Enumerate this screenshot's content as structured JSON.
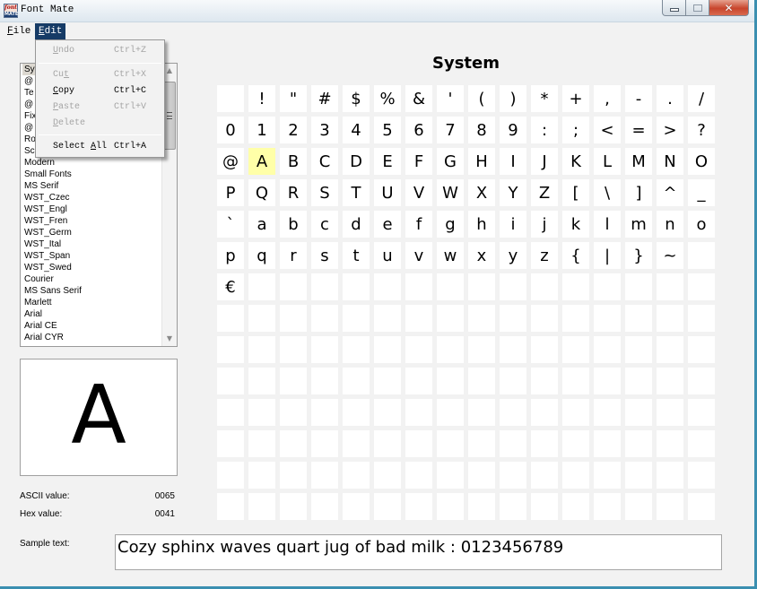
{
  "window": {
    "title": "Font Mate",
    "icon_top": "font",
    "icon_bottom": "MATE",
    "controls": {
      "minimize": "minimize-icon",
      "maximize": "maximize-icon",
      "close_glyph": "✕"
    }
  },
  "menubar": {
    "file": {
      "accel": "F",
      "rest": "ile"
    },
    "edit": {
      "accel": "E",
      "rest": "dit"
    }
  },
  "edit_menu": {
    "items": [
      {
        "pre": "",
        "accel": "U",
        "post": "ndo",
        "shortcut": "Ctrl+Z",
        "enabled": false
      },
      {
        "pre": "Cu",
        "accel": "t",
        "post": "",
        "shortcut": "Ctrl+X",
        "enabled": false
      },
      {
        "pre": "",
        "accel": "C",
        "post": "opy",
        "shortcut": "Ctrl+C",
        "enabled": true
      },
      {
        "pre": "",
        "accel": "P",
        "post": "aste",
        "shortcut": "Ctrl+V",
        "enabled": false
      },
      {
        "pre": "",
        "accel": "D",
        "post": "elete",
        "shortcut": "",
        "enabled": false
      },
      {
        "pre": "Select ",
        "accel": "A",
        "post": "ll",
        "shortcut": "Ctrl+A",
        "enabled": true
      }
    ]
  },
  "font_list": {
    "selected_index": 0,
    "items": [
      "Sy",
      "@",
      "Te",
      "@",
      "Fix",
      "@",
      "Ro",
      "Sc",
      "Modern",
      "Small Fonts",
      "MS Serif",
      "WST_Czec",
      "WST_Engl",
      "WST_Fren",
      "WST_Germ",
      "WST_Ital",
      "WST_Span",
      "WST_Swed",
      "Courier",
      "MS Sans Serif",
      "Marlett",
      "Arial",
      "Arial CE",
      "Arial CYR"
    ],
    "scroll_up": "▲",
    "scroll_down": "▼"
  },
  "preview": {
    "char": "A"
  },
  "info": {
    "ascii_label": "ASCII value:",
    "ascii_value": "0065",
    "hex_label": "Hex value:",
    "hex_value": "0041"
  },
  "sample": {
    "label": "Sample text:",
    "text": "Cozy sphinx waves quart jug of bad milk : 0123456789"
  },
  "char_map": {
    "font_name": "System",
    "selected_char": "A",
    "rows": [
      [
        " ",
        "!",
        "\"",
        "#",
        "$",
        "%",
        "&",
        "'",
        "(",
        ")",
        "*",
        "+",
        ",",
        "-",
        ".",
        "/"
      ],
      [
        "0",
        "1",
        "2",
        "3",
        "4",
        "5",
        "6",
        "7",
        "8",
        "9",
        ":",
        ";",
        "<",
        "=",
        ">",
        "?"
      ],
      [
        "@",
        "A",
        "B",
        "C",
        "D",
        "E",
        "F",
        "G",
        "H",
        "I",
        "J",
        "K",
        "L",
        "M",
        "N",
        "O"
      ],
      [
        "P",
        "Q",
        "R",
        "S",
        "T",
        "U",
        "V",
        "W",
        "X",
        "Y",
        "Z",
        "[",
        "\\",
        "]",
        "^",
        "_"
      ],
      [
        "`",
        "a",
        "b",
        "c",
        "d",
        "e",
        "f",
        "g",
        "h",
        "i",
        "j",
        "k",
        "l",
        "m",
        "n",
        "o"
      ],
      [
        "p",
        "q",
        "r",
        "s",
        "t",
        "u",
        "v",
        "w",
        "x",
        "y",
        "z",
        "{",
        "|",
        "}",
        "~",
        ""
      ],
      [
        "€",
        "",
        "",
        "",
        "",
        "",
        "",
        "",
        "",
        "",
        "",
        "",
        "",
        "",
        "",
        ""
      ],
      [
        "",
        "",
        "",
        "",
        "",
        "",
        "",
        "",
        "",
        "",
        "",
        "",
        "",
        "",
        "",
        ""
      ],
      [
        "",
        "",
        "",
        "",
        "",
        "",
        "",
        "",
        "",
        "",
        "",
        "",
        "",
        "",
        "",
        ""
      ],
      [
        "",
        "",
        "",
        "",
        "",
        "",
        "",
        "",
        "",
        "",
        "",
        "",
        "",
        "",
        "",
        ""
      ],
      [
        "",
        "",
        "",
        "",
        "",
        "",
        "",
        "",
        "",
        "",
        "",
        "",
        "",
        "",
        "",
        ""
      ],
      [
        "",
        "",
        "",
        "",
        "",
        "",
        "",
        "",
        "",
        "",
        "",
        "",
        "",
        "",
        "",
        ""
      ],
      [
        "",
        "",
        "",
        "",
        "",
        "",
        "",
        "",
        "",
        "",
        "",
        "",
        "",
        "",
        "",
        ""
      ],
      [
        "",
        "",
        "",
        "",
        "",
        "",
        "",
        "",
        "",
        "",
        "",
        "",
        "",
        "",
        "",
        ""
      ]
    ]
  },
  "colors": {
    "menu_highlight": "#163b66",
    "selected_cell": "#ffffa8",
    "window_border": "#3b8fb0"
  }
}
